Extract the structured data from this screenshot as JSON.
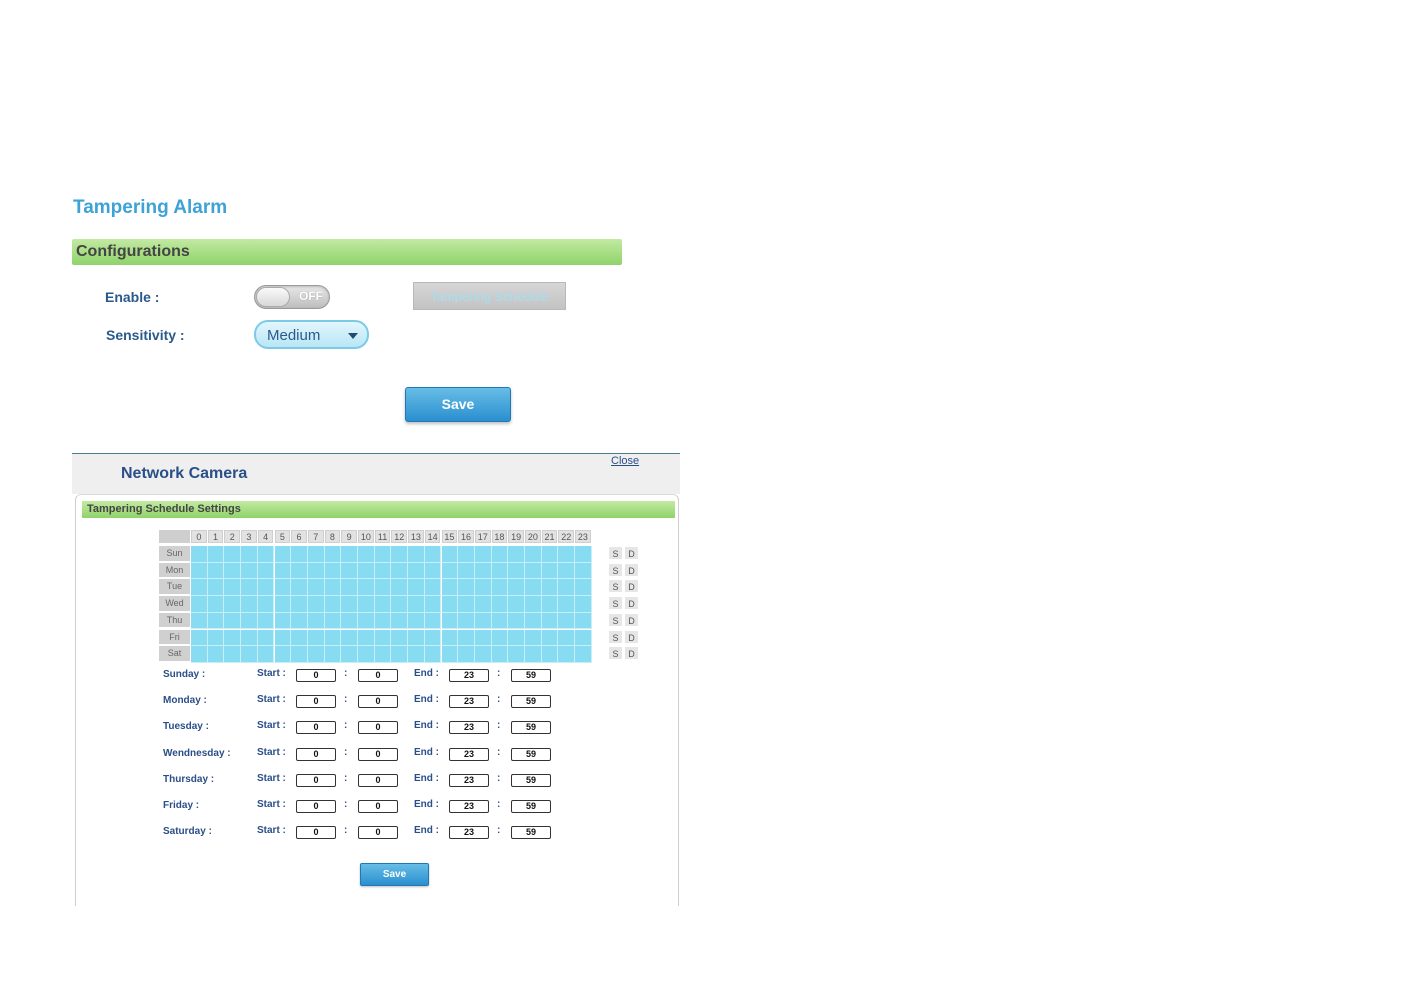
{
  "page": {
    "title": "Tampering Alarm"
  },
  "config": {
    "section_title": "Configurations",
    "enable_label": "Enable :",
    "enable_state": "OFF",
    "schedule_button": "Tampering Schedule",
    "sensitivity_label": "Sensitivity :",
    "sensitivity_value": "Medium",
    "save_label": "Save"
  },
  "popup": {
    "title": "Network Camera",
    "close_label": "Close",
    "section_title": "Tampering Schedule Settings",
    "hours": [
      "0",
      "1",
      "2",
      "3",
      "4",
      "5",
      "6",
      "7",
      "8",
      "9",
      "10",
      "11",
      "12",
      "13",
      "14",
      "15",
      "16",
      "17",
      "18",
      "19",
      "20",
      "21",
      "22",
      "23"
    ],
    "days": [
      "Sun",
      "Mon",
      "Tue",
      "Wed",
      "Thu",
      "Fri",
      "Sat"
    ],
    "s_label": "S",
    "d_label": "D",
    "start_label": "Start :",
    "end_label": "End :",
    "colon": ":",
    "rows": [
      {
        "day": "Sunday :",
        "start_h": "0",
        "start_m": "0",
        "end_h": "23",
        "end_m": "59"
      },
      {
        "day": "Monday :",
        "start_h": "0",
        "start_m": "0",
        "end_h": "23",
        "end_m": "59"
      },
      {
        "day": "Tuesday :",
        "start_h": "0",
        "start_m": "0",
        "end_h": "23",
        "end_m": "59"
      },
      {
        "day": "Wendnesday :",
        "start_h": "0",
        "start_m": "0",
        "end_h": "23",
        "end_m": "59"
      },
      {
        "day": "Thursday :",
        "start_h": "0",
        "start_m": "0",
        "end_h": "23",
        "end_m": "59"
      },
      {
        "day": "Friday :",
        "start_h": "0",
        "start_m": "0",
        "end_h": "23",
        "end_m": "59"
      },
      {
        "day": "Saturday :",
        "start_h": "0",
        "start_m": "0",
        "end_h": "23",
        "end_m": "59"
      }
    ],
    "save_label": "Save"
  },
  "colors": {
    "accent": "#3da2d6",
    "grid_cell": "#87dcf2",
    "section_bar": "#a6de84"
  }
}
